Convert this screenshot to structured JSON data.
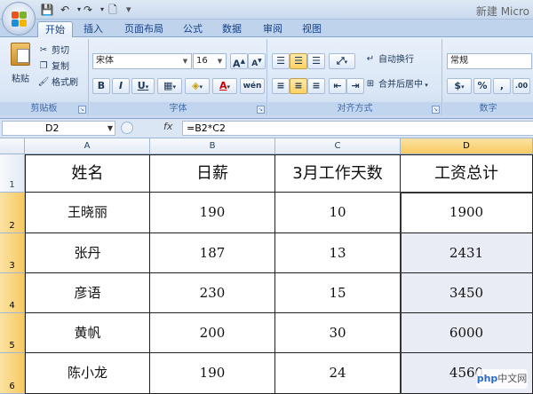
{
  "window": {
    "title": "新建 Micro"
  },
  "quick_access": {
    "save_icon": "save-icon",
    "undo_icon": "undo-icon",
    "redo_icon": "redo-icon",
    "preview_icon": "print-preview-icon",
    "customize_icon": "customize-icon"
  },
  "tabs": [
    "开始",
    "插入",
    "页面布局",
    "公式",
    "数据",
    "审阅",
    "视图"
  ],
  "ribbon": {
    "clipboard": {
      "label": "剪贴板",
      "paste": "粘贴",
      "cut": "剪切",
      "copy": "复制",
      "format_painter": "格式刷"
    },
    "font": {
      "label": "字体",
      "name": "宋体",
      "size": "16",
      "grow": "A",
      "shrink": "A",
      "bold": "B",
      "italic": "I",
      "underline": "U",
      "phonetic": "wén"
    },
    "alignment": {
      "label": "对齐方式",
      "wrap": "自动换行",
      "merge": "合并后居中"
    },
    "number": {
      "label": "数字",
      "format": "常规",
      "percent": "%"
    }
  },
  "formula_bar": {
    "cell_ref": "D2",
    "fx": "fx",
    "formula": "=B2*C2"
  },
  "columns": [
    "A",
    "B",
    "C",
    "D"
  ],
  "rows": [
    "1",
    "2",
    "3",
    "4",
    "5",
    "6"
  ],
  "table": {
    "header": [
      "姓名",
      "日薪",
      "3月工作天数",
      "工资总计"
    ],
    "data": [
      [
        "王晓丽",
        "190",
        "10",
        "1900"
      ],
      [
        "张丹",
        "187",
        "13",
        "2431"
      ],
      [
        "彦语",
        "230",
        "15",
        "3450"
      ],
      [
        "黄帆",
        "200",
        "30",
        "6000"
      ],
      [
        "陈小龙",
        "190",
        "24",
        "4560"
      ]
    ]
  },
  "watermark": {
    "text": "php",
    "suffix": "中文网"
  },
  "colors": {
    "accent": "#15428b",
    "selection": "#f8c962"
  }
}
